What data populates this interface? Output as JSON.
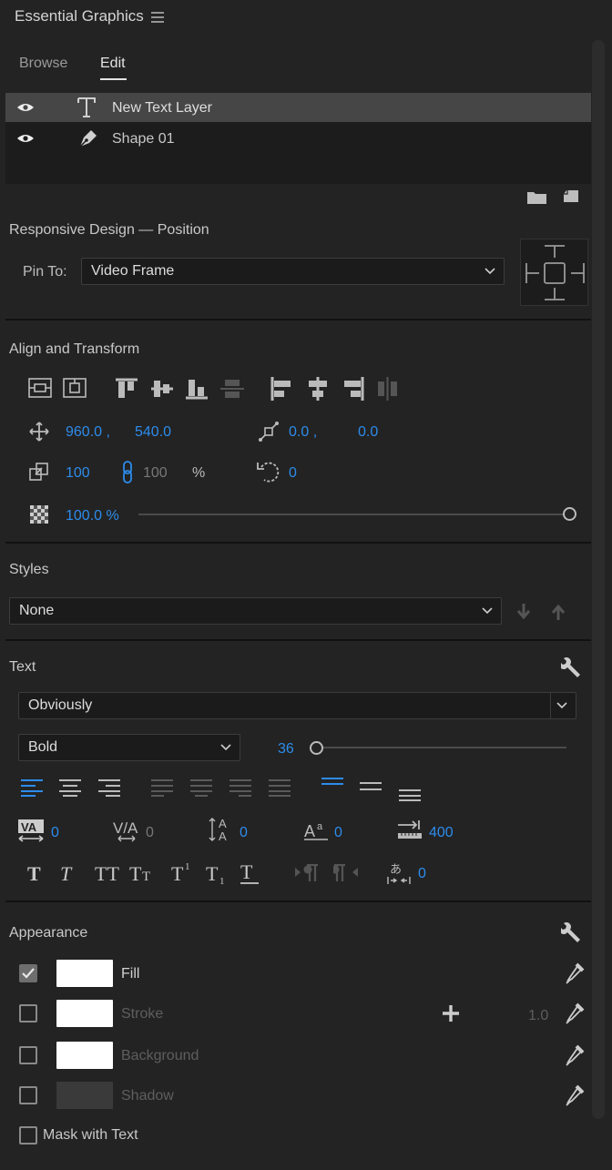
{
  "panel": {
    "title": "Essential Graphics"
  },
  "tabs": [
    {
      "label": "Browse"
    },
    {
      "label": "Edit"
    }
  ],
  "layers": [
    {
      "name": "New Text Layer"
    },
    {
      "name": "Shape 01"
    }
  ],
  "responsive": {
    "heading": "Responsive Design — Position",
    "pin_label": "Pin To:",
    "pin_value": "Video Frame"
  },
  "align": {
    "heading": "Align and Transform",
    "pos_x": "960.0 ,",
    "pos_y": "540.0",
    "anchor_x": "0.0 ,",
    "anchor_y": "0.0",
    "scale": "100",
    "scale_w": "100",
    "scale_unit": "%",
    "rotation": "0",
    "opacity": "100.0 %",
    "opacity_fraction": 1.0
  },
  "styles": {
    "heading": "Styles",
    "value": "None"
  },
  "text": {
    "heading": "Text",
    "font": "Obviously",
    "weight": "Bold",
    "size": "36",
    "size_fraction": 0.0,
    "kerning": "0",
    "tracking": "0",
    "leading": "0",
    "baseline": "0",
    "tab_width": "400",
    "tsume": "0"
  },
  "appearance": {
    "heading": "Appearance",
    "items": [
      {
        "label": "Fill",
        "checked": true
      },
      {
        "label": "Stroke",
        "checked": false,
        "width": "1.0"
      },
      {
        "label": "Background",
        "checked": false
      },
      {
        "label": "Shadow",
        "checked": false
      }
    ],
    "mask_label": "Mask with Text"
  },
  "colors": {
    "accent": "#2d8ceb",
    "bg": "#232323",
    "layers_bg": "#1c1c1c",
    "selected": "#464646"
  }
}
